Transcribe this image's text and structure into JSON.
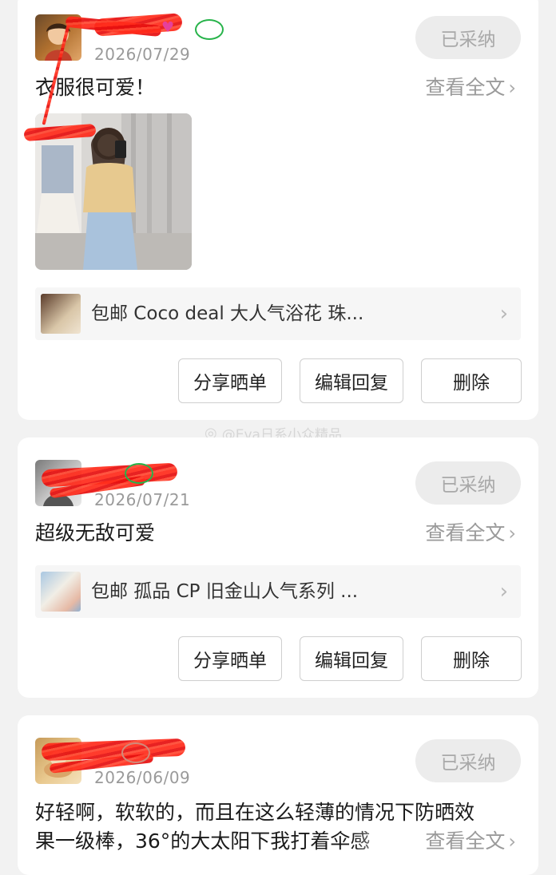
{
  "watermark": "@Eva日系小众精品",
  "reviews": [
    {
      "date": "2026/07/29",
      "adopted_label": "已采纳",
      "content": "衣服很可爱！",
      "view_all_label": "查看全文",
      "product_title": "包邮 Coco deal 大人气浴花 珠...",
      "actions": [
        "分享晒单",
        "编辑回复",
        "删除"
      ]
    },
    {
      "date": "2026/07/21",
      "adopted_label": "已采纳",
      "content": "超级无敌可爱",
      "view_all_label": "查看全文",
      "product_title": "包邮 孤品 CP 旧金山人气系列 ...",
      "actions": [
        "分享晒单",
        "编辑回复",
        "删除"
      ]
    },
    {
      "date": "2026/06/09",
      "adopted_label": "已采纳",
      "content_line1": "好轻啊，软软的，而且在这么轻薄的情况下防晒效",
      "content_line2": "果一级棒，36°的大太阳下我打着伞感",
      "view_all_label": "查看全文"
    }
  ],
  "colors": {
    "background": "#f2f2f2",
    "card": "#ffffff",
    "adopted_bg": "#ececec",
    "adopted_text": "#a9a9a9",
    "redaction": "#ff2a1a",
    "badge_green": "#27b34a"
  }
}
